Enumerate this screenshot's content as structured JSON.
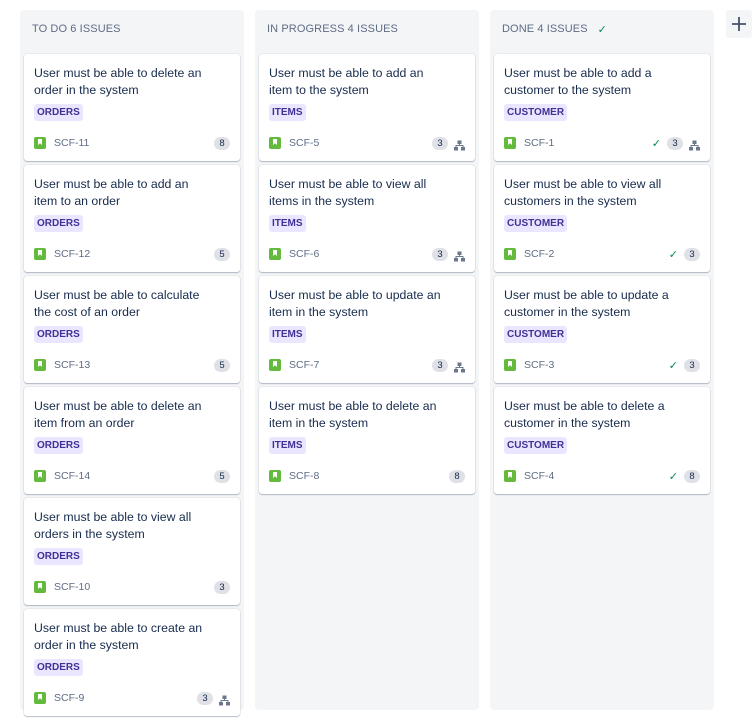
{
  "columns": [
    {
      "id": "todo",
      "title": "TO DO 6 ISSUES",
      "show_check": false,
      "cards": [
        {
          "summary": "User must be able to delete an order in the system",
          "epic": "ORDERS",
          "key": "SCF-11",
          "points": "8",
          "done": false,
          "subtasks": false
        },
        {
          "summary": "User must be able to add an item to an order",
          "epic": "ORDERS",
          "key": "SCF-12",
          "points": "5",
          "done": false,
          "subtasks": false
        },
        {
          "summary": "User must be able to calculate the cost of an order",
          "epic": "ORDERS",
          "key": "SCF-13",
          "points": "5",
          "done": false,
          "subtasks": false
        },
        {
          "summary": "User must be able to delete an item from an order",
          "epic": "ORDERS",
          "key": "SCF-14",
          "points": "5",
          "done": false,
          "subtasks": false
        },
        {
          "summary": "User must be able to view all orders in the system",
          "epic": "ORDERS",
          "key": "SCF-10",
          "points": "3",
          "done": false,
          "subtasks": false
        },
        {
          "summary": "User must be able to create an order in the system",
          "epic": "ORDERS",
          "key": "SCF-9",
          "points": "3",
          "done": false,
          "subtasks": true
        }
      ]
    },
    {
      "id": "inprogress",
      "title": "IN PROGRESS 4 ISSUES",
      "show_check": false,
      "cards": [
        {
          "summary": "User must be able to add an item to the system",
          "epic": "ITEMS",
          "key": "SCF-5",
          "points": "3",
          "done": false,
          "subtasks": true
        },
        {
          "summary": "User must be able to view all items in the system",
          "epic": "ITEMS",
          "key": "SCF-6",
          "points": "3",
          "done": false,
          "subtasks": true
        },
        {
          "summary": "User must be able to update an item in the system",
          "epic": "ITEMS",
          "key": "SCF-7",
          "points": "3",
          "done": false,
          "subtasks": true
        },
        {
          "summary": "User must be able to delete an item in the system",
          "epic": "ITEMS",
          "key": "SCF-8",
          "points": "8",
          "done": false,
          "subtasks": false
        }
      ]
    },
    {
      "id": "done",
      "title": "DONE 4 ISSUES",
      "show_check": true,
      "cards": [
        {
          "summary": "User must be able to add a customer to the system",
          "epic": "CUSTOMER",
          "key": "SCF-1",
          "points": "3",
          "done": true,
          "subtasks": true
        },
        {
          "summary": "User must be able to view all customers in the system",
          "epic": "CUSTOMER",
          "key": "SCF-2",
          "points": "3",
          "done": true,
          "subtasks": false
        },
        {
          "summary": "User must be able to update a customer in the system",
          "epic": "CUSTOMER",
          "key": "SCF-3",
          "points": "3",
          "done": true,
          "subtasks": false
        },
        {
          "summary": "User must be able to delete a customer in the system",
          "epic": "CUSTOMER",
          "key": "SCF-4",
          "points": "8",
          "done": true,
          "subtasks": false
        }
      ]
    }
  ],
  "colors": {
    "epic_bg": "#eae6ff",
    "epic_text": "#403294",
    "story_icon": "#63ba3c",
    "done_check": "#00875a",
    "column_bg": "#f4f5f7"
  },
  "icons": {
    "story": "story-bookmark-icon",
    "done": "check-icon",
    "subtasks": "subtasks-icon",
    "add_column": "plus-icon"
  }
}
